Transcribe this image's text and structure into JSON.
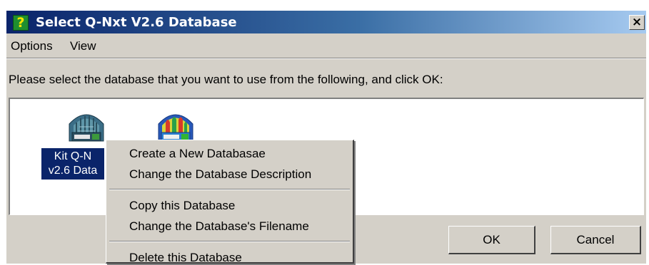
{
  "window": {
    "title": "Select Q-Nxt V2.6 Database",
    "title_icon_glyph": "?",
    "close_glyph": "×",
    "colors": {
      "titlebar_start": "#0a246a",
      "titlebar_end": "#a6caf0",
      "face": "#d4d0c8",
      "selection": "#0a246a"
    }
  },
  "menubar": {
    "items": [
      {
        "label": "Options"
      },
      {
        "label": "View"
      }
    ]
  },
  "prompt": "Please select the database that you want to use from the following, and click OK:",
  "databases": [
    {
      "label_line1": "Kit Q-N",
      "label_line2": "v2.6 Data",
      "icon": "database-icon-blue",
      "selected": true
    },
    {
      "icon": "database-icon-green",
      "selected": false
    }
  ],
  "buttons": {
    "ok": "OK",
    "cancel": "Cancel"
  },
  "context_menu": {
    "groups": [
      [
        "Create a New Databasae",
        "Change the Database Description"
      ],
      [
        "Copy this Database",
        "Change the Database's Filename"
      ],
      [
        "Delete this Database"
      ]
    ]
  }
}
